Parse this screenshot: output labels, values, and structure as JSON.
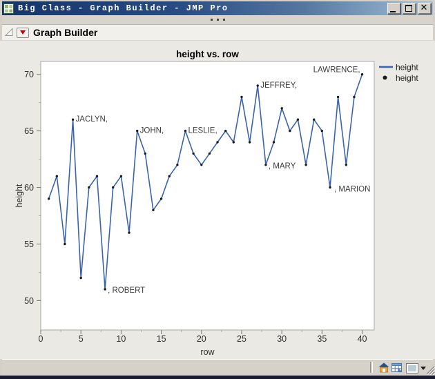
{
  "window": {
    "title": "Big Class - Graph Builder - JMP Pro",
    "buttons": [
      {
        "name": "minimize"
      },
      {
        "name": "maximize"
      },
      {
        "name": "close"
      }
    ],
    "app_icon": "jmp-table-icon"
  },
  "toolbar": {
    "handle_icon": "ellipsis-dots"
  },
  "outline": {
    "title": "Graph Builder"
  },
  "chart_data": {
    "type": "line",
    "title": "height vs. row",
    "xlabel": "row",
    "ylabel": "height",
    "x": [
      1,
      2,
      3,
      4,
      5,
      6,
      7,
      8,
      9,
      10,
      11,
      12,
      13,
      14,
      15,
      16,
      17,
      18,
      19,
      20,
      21,
      22,
      23,
      24,
      25,
      26,
      27,
      28,
      29,
      30,
      31,
      32,
      33,
      34,
      35,
      36,
      37,
      38,
      39,
      40
    ],
    "y": [
      59,
      61,
      55,
      66,
      52,
      60,
      61,
      51,
      60,
      61,
      56,
      65,
      63,
      58,
      59,
      61,
      62,
      65,
      63,
      62,
      63,
      64,
      65,
      64,
      68,
      64,
      69,
      62,
      64,
      67,
      65,
      66,
      62,
      66,
      65,
      60,
      68,
      62,
      68,
      70
    ],
    "x_ticks": [
      0,
      5,
      10,
      15,
      20,
      25,
      30,
      35,
      40
    ],
    "y_ticks": [
      50,
      55,
      60,
      65,
      70
    ],
    "xlim": [
      0,
      41.5
    ],
    "ylim": [
      47.4,
      71.14
    ],
    "minor_step": 2.5,
    "grid": false,
    "legend_position": "right-top",
    "legend": [
      {
        "label": "height",
        "swatch": "line"
      },
      {
        "label": "height",
        "swatch": "dot"
      }
    ],
    "line_color": "#3a63ae",
    "marker_color": "#1c1c1c",
    "point_labels": [
      {
        "row": 4,
        "text": "JACLYN,",
        "anchor": "start",
        "dx": 4,
        "dy": 3
      },
      {
        "row": 8,
        "text": ", ROBERT",
        "anchor": "start",
        "dx": 4,
        "dy": 5
      },
      {
        "row": 12,
        "text": "JOHN,",
        "anchor": "start",
        "dx": 4,
        "dy": 3
      },
      {
        "row": 18,
        "text": "LESLIE,",
        "anchor": "start",
        "dx": 4,
        "dy": 3
      },
      {
        "row": 27,
        "text": "JEFFREY,",
        "anchor": "start",
        "dx": 4,
        "dy": 3
      },
      {
        "row": 28,
        "text": ", MARY",
        "anchor": "start",
        "dx": 4,
        "dy": 5
      },
      {
        "row": 36,
        "text": ", MARION",
        "anchor": "start",
        "dx": 6,
        "dy": 6
      },
      {
        "row": 40,
        "text": "LAWRENCE,",
        "anchor": "end",
        "dx": -3,
        "dy": -3
      }
    ]
  },
  "status_bar": {
    "icons": [
      "home-icon",
      "data-table-icon",
      "background-color-swatch",
      "dropdown-arrow-icon",
      "resize-grip-icon"
    ],
    "swatch_color": "#b9ccd2"
  },
  "colors": {
    "series_line": "#3a63ae",
    "titlebar_left": "#15356a",
    "titlebar_right": "#a9c1d8",
    "panel_bg": "#ebe9e3"
  }
}
